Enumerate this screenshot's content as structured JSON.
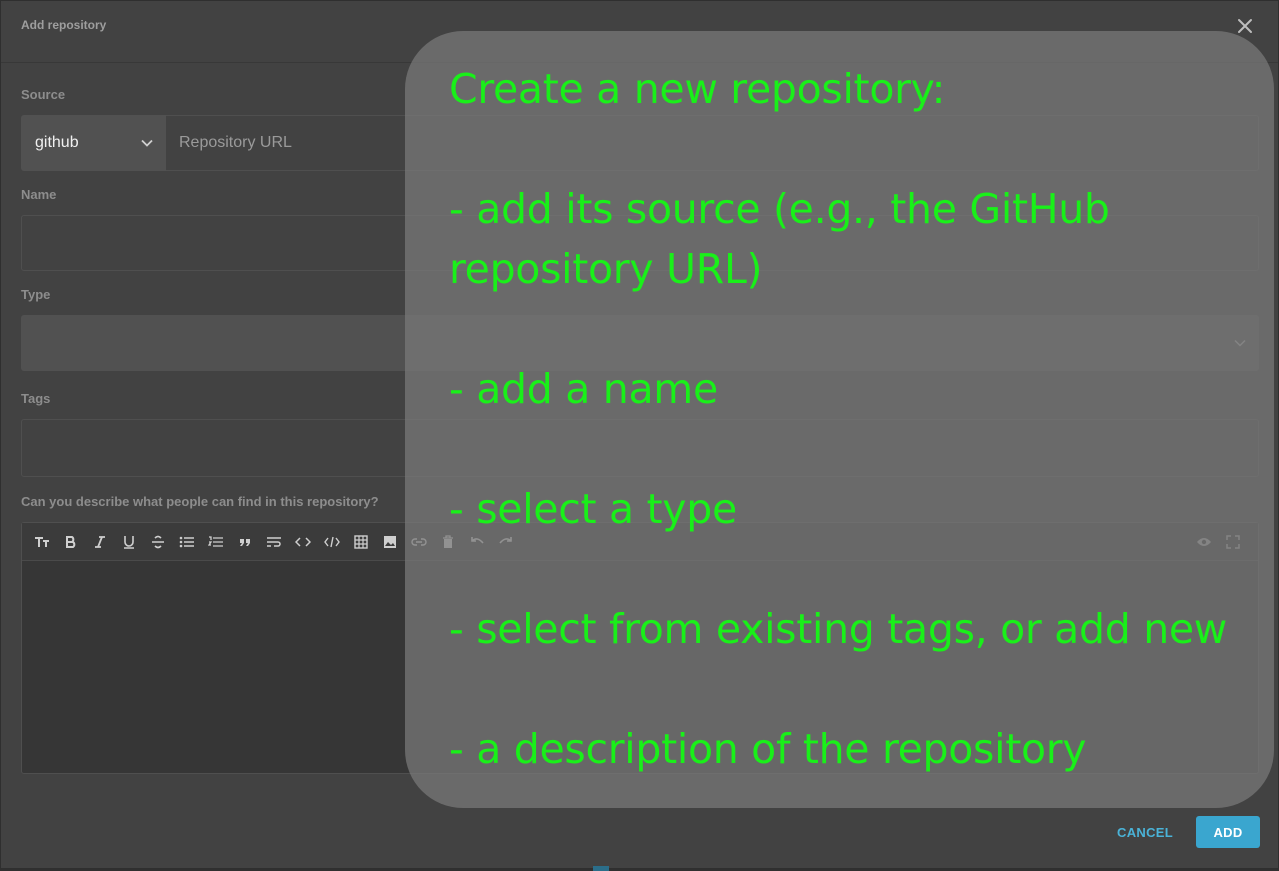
{
  "dialog": {
    "title": "Add repository",
    "close_icon": "close-icon"
  },
  "form": {
    "source_label": "Source",
    "source_value": "github",
    "url_placeholder": "Repository URL",
    "name_label": "Name",
    "type_label": "Type",
    "tags_label": "Tags",
    "description_label": "Can you describe what people can find in this repository?"
  },
  "editor": {
    "toolbar": [
      "heading-icon",
      "bold-icon",
      "italic-icon",
      "underline-icon",
      "strikethrough-icon",
      "bullet-list-icon",
      "numbered-list-icon",
      "quote-icon",
      "wrap-text-icon",
      "code-icon",
      "code-block-icon",
      "table-icon",
      "image-icon",
      "link-icon",
      "delete-icon",
      "undo-icon",
      "redo-icon"
    ],
    "right_tools": [
      "preview-eye-icon",
      "fullscreen-icon"
    ]
  },
  "actions": {
    "cancel_label": "CANCEL",
    "add_label": "ADD"
  },
  "overlay": {
    "line1": "Create a new repository:",
    "line2": "- add its source (e.g., the GitHub repository URL)",
    "line3": "- add a name",
    "line4": "- select a type",
    "line5": "- select from existing tags, or add new",
    "line6": "- a description of the repository"
  },
  "colors": {
    "accent": "#3aa6cf",
    "overlay_text": "#19f019",
    "dialog_bg": "#424242"
  }
}
